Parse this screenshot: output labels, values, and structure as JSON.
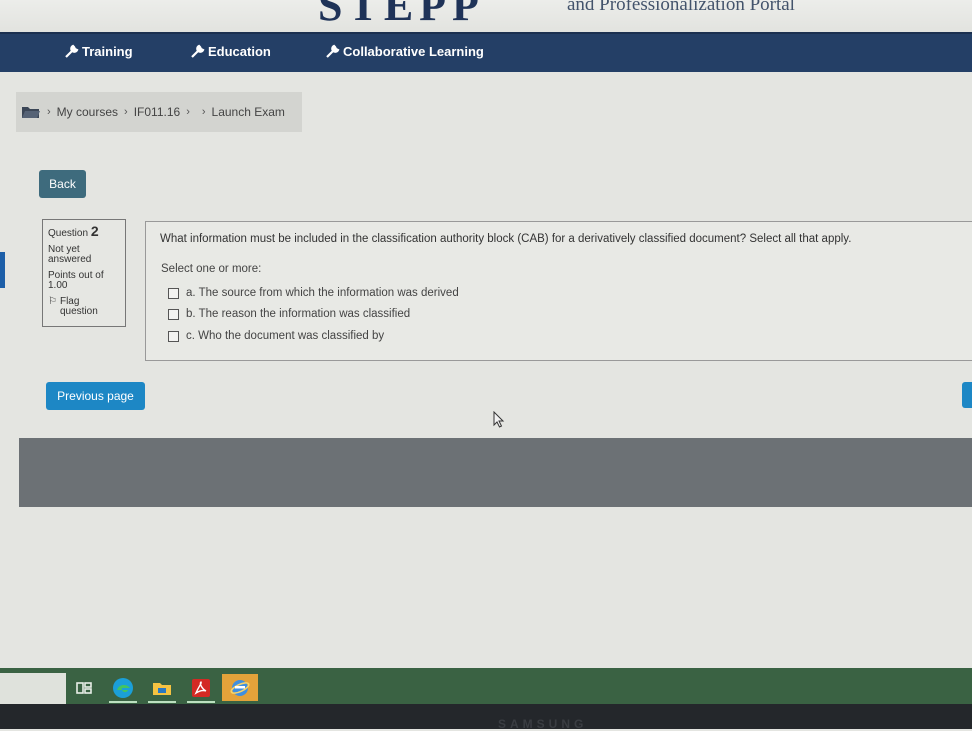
{
  "banner": {
    "logo_text": "STEPP",
    "portal_text": "and Professionalization Portal"
  },
  "nav": {
    "items": [
      {
        "label": "Training",
        "icon": "wrench-icon"
      },
      {
        "label": "Education",
        "icon": "wrench-icon"
      },
      {
        "label": "Collaborative Learning",
        "icon": "wrench-icon"
      }
    ]
  },
  "breadcrumb": {
    "icon": "folder-icon",
    "items": [
      "My courses",
      "IF011.16",
      "Launch Exam"
    ]
  },
  "buttons": {
    "back": "Back",
    "previous_page": "Previous page"
  },
  "question_info": {
    "label": "Question",
    "number": "2",
    "status": "Not yet answered",
    "points": "Points out of 1.00",
    "flag": "Flag question"
  },
  "question": {
    "text": "What information must be included in the classification authority block (CAB) for a derivatively classified document? Select all that apply.",
    "prompt": "Select one or more:",
    "options": [
      "a. The source from which the information was derived",
      "b. The reason the information was classified",
      "c. Who the document was classified by"
    ]
  },
  "taskbar": {
    "icons": [
      "task-view-icon",
      "edge-icon",
      "file-explorer-icon",
      "acrobat-icon",
      "internet-explorer-icon"
    ]
  },
  "monitor": {
    "brand": "SAMSUNG"
  },
  "colors": {
    "nav_bg": "#243f66",
    "primary_button": "#1d87c5",
    "back_button": "#3e6b7d",
    "taskbar": "#3a6243"
  }
}
